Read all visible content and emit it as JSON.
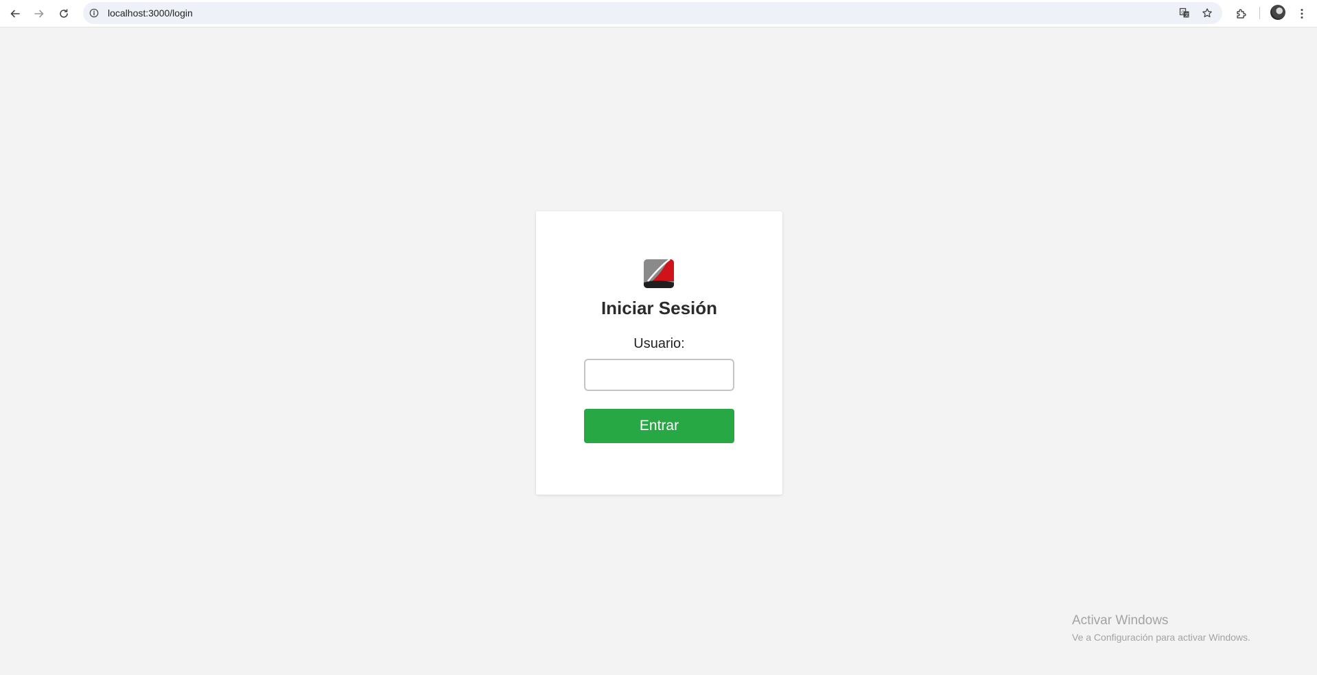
{
  "browser": {
    "url": "localhost:3000/login",
    "icons": {
      "back": "back-arrow-icon",
      "forward": "forward-arrow-icon",
      "reload": "reload-icon",
      "site_info": "info-icon",
      "translate": "translate-icon",
      "bookmark": "star-icon",
      "extensions": "puzzle-icon",
      "menu": "kebab-menu-icon"
    }
  },
  "login": {
    "title": "Iniciar Sesión",
    "user_label": "Usuario:",
    "user_value": "",
    "submit_label": "Entrar",
    "accent_color": "#28a745",
    "logo": "company-logo"
  },
  "watermark": {
    "title": "Activar Windows",
    "subtitle": "Ve a Configuración para activar Windows."
  }
}
